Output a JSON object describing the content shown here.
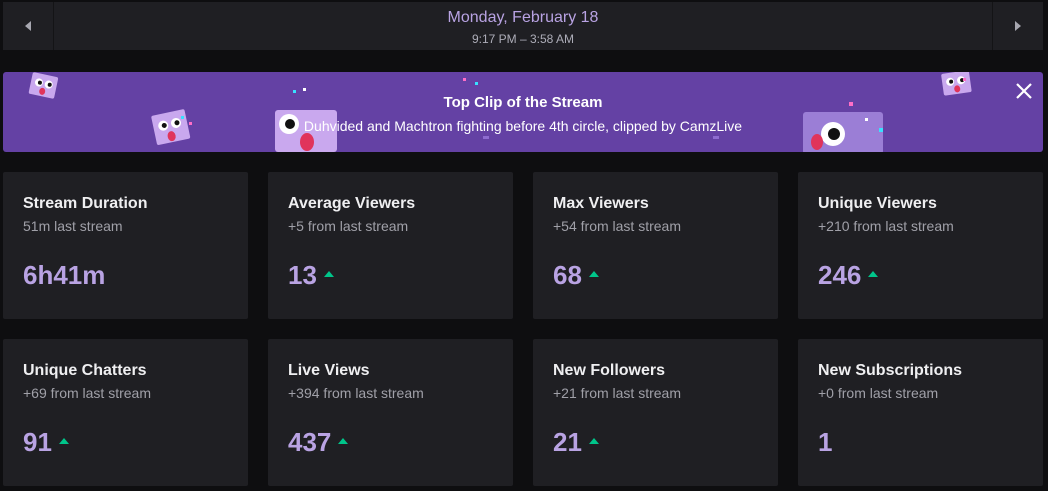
{
  "date_nav": {
    "title": "Monday, February 18",
    "time_range": "9:17 PM – 3:58 AM"
  },
  "banner": {
    "title": "Top Clip of the Stream",
    "subtitle": "Duhvided and Machtron fighting before 4th circle, clipped by CamzLive",
    "background_color": "#6441a4"
  },
  "stats": [
    {
      "title": "Stream Duration",
      "subtitle": "51m last stream",
      "value": "6h41m",
      "trend": "none"
    },
    {
      "title": "Average Viewers",
      "subtitle": "+5 from last stream",
      "value": "13",
      "trend": "up"
    },
    {
      "title": "Max Viewers",
      "subtitle": "+54 from last stream",
      "value": "68",
      "trend": "up"
    },
    {
      "title": "Unique Viewers",
      "subtitle": "+210 from last stream",
      "value": "246",
      "trend": "up"
    },
    {
      "title": "Unique Chatters",
      "subtitle": "+69 from last stream",
      "value": "91",
      "trend": "up"
    },
    {
      "title": "Live Views",
      "subtitle": "+394 from last stream",
      "value": "437",
      "trend": "up"
    },
    {
      "title": "New Followers",
      "subtitle": "+21 from last stream",
      "value": "21",
      "trend": "up"
    },
    {
      "title": "New Subscriptions",
      "subtitle": "+0 from last stream",
      "value": "1",
      "trend": "none"
    }
  ],
  "colors": {
    "accent_value": "#b9a3e3",
    "trend_up": "#00c58a",
    "card_bg": "#1f1f23",
    "page_bg": "#0e0e10"
  },
  "icons": {
    "prev": "chevron-left-icon",
    "next": "chevron-right-icon",
    "close": "close-icon",
    "trend": "trend-up-icon"
  }
}
